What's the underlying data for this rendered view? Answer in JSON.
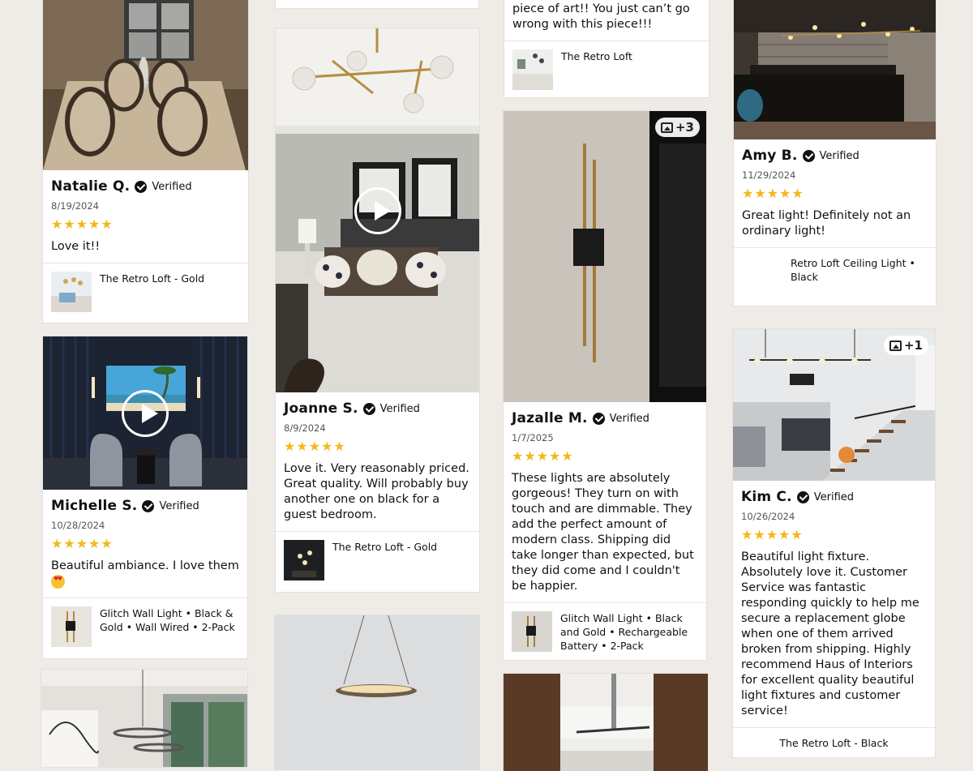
{
  "verified_label": "Verified",
  "stars": "★★★★★",
  "reviews": [
    {
      "name": "Natalie Q.",
      "date": "8/19/2024",
      "text": "Love it!!",
      "product": "The Retro Loft - Gold"
    },
    {
      "name": "Michelle S.",
      "date": "10/28/2024",
      "text": "Beautiful ambiance. I love them",
      "product": "Glitch Wall Light • Black & Gold • Wall Wired • 2-Pack"
    },
    {
      "name": "Joanne S.",
      "date": "8/9/2024",
      "text": "Love it. Very reasonably priced. Great quality. Will probably buy another one on black for a guest bedroom.",
      "product": "The Retro Loft - Gold"
    },
    {
      "top_text": "piece of art!!  You just can’t go wrong with this piece!!!",
      "product": "The Retro Loft"
    },
    {
      "name": "Jazalle M.",
      "date": "1/7/2025",
      "text": "These lights are absolutely gorgeous! They turn on with touch and are dimmable. They add the perfect amount of modern class. Shipping did take longer than expected, but they did come and I couldn't be happier.",
      "product": "Glitch Wall Light • Black and Gold • Rechargeable Battery • 2-Pack",
      "badge": "+3"
    },
    {
      "name": "Amy B.",
      "date": "11/29/2024",
      "text": "Great light! Definitely not an ordinary light!",
      "product": "Retro Loft Ceiling Light • Black"
    },
    {
      "name": "Kim C.",
      "date": "10/26/2024",
      "text": "Beautiful light fixture. Absolutely love it. Customer Service was fantastic responding quickly to help me secure a replacement globe when one of them arrived broken from shipping. Highly recommend Haus of Interiors for excellent quality beautiful light fixtures and customer service!",
      "product": "The Retro Loft - Black",
      "badge": "+1"
    }
  ]
}
